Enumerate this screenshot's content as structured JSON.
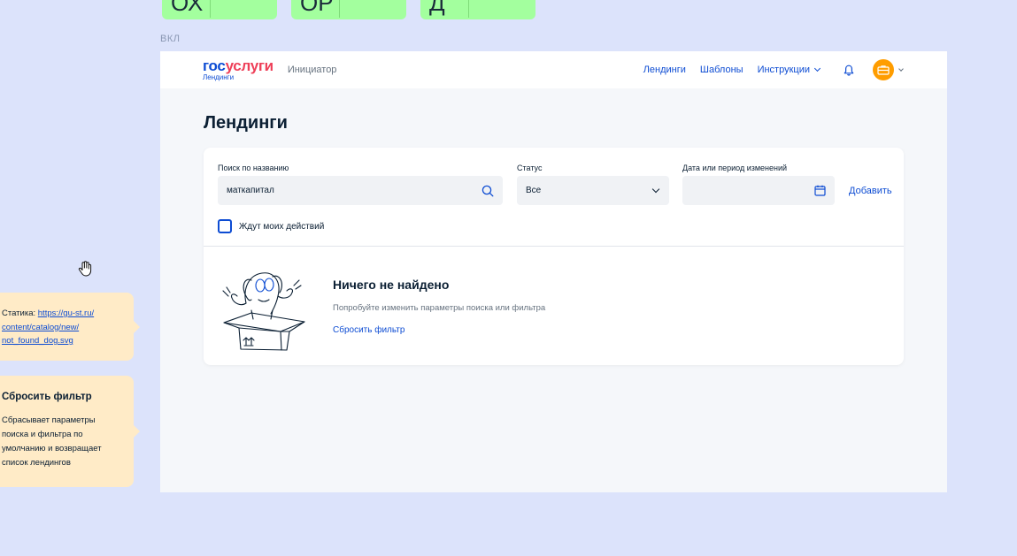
{
  "top_chips": [
    "ОХ",
    "ОР",
    "Д"
  ],
  "state_label": "ВКЛ",
  "header": {
    "logo_main_part1": "гос",
    "logo_main_part2": "услуги",
    "logo_sub": "Лендинги",
    "role": "Инициатор",
    "nav": [
      {
        "label": "Лендинги"
      },
      {
        "label": "Шаблоны"
      },
      {
        "label": "Инструкции"
      }
    ]
  },
  "page": {
    "title": "Лендинги"
  },
  "filters": {
    "search_label": "Поиск по названию",
    "search_value": "маткапитал",
    "status_label": "Статус",
    "status_value": "Все",
    "date_label": "Дата или период изменений",
    "date_value": "",
    "add_label": "Добавить",
    "checkbox_label": "Ждут моих действий",
    "checkbox_checked": false
  },
  "empty_state": {
    "title": "Ничего не найдено",
    "description": "Попробуйте изменить параметры поиска или фильтра",
    "reset_label": "Сбросить фильтр"
  },
  "annotations": {
    "static_prefix": "Статика: ",
    "static_link_line1": "https://gu-st.ru/",
    "static_link_line2": "content/catalog/new/",
    "static_link_line3": "not_found_dog.svg",
    "reset_title": "Сбросить фильтр",
    "reset_desc_line1": "Сбрасывает параметры",
    "reset_desc_line2": "поиска и фильтра по",
    "reset_desc_line3": "умолчанию и возвращает",
    "reset_desc_line4": "список лендингов"
  },
  "colors": {
    "background": "#dce3fb",
    "brand_blue": "#0d4cd3",
    "brand_red": "#ee3f58",
    "chip_green": "#a3ff9e",
    "annotation": "#ffebc7",
    "avatar": "#ff9d00"
  }
}
